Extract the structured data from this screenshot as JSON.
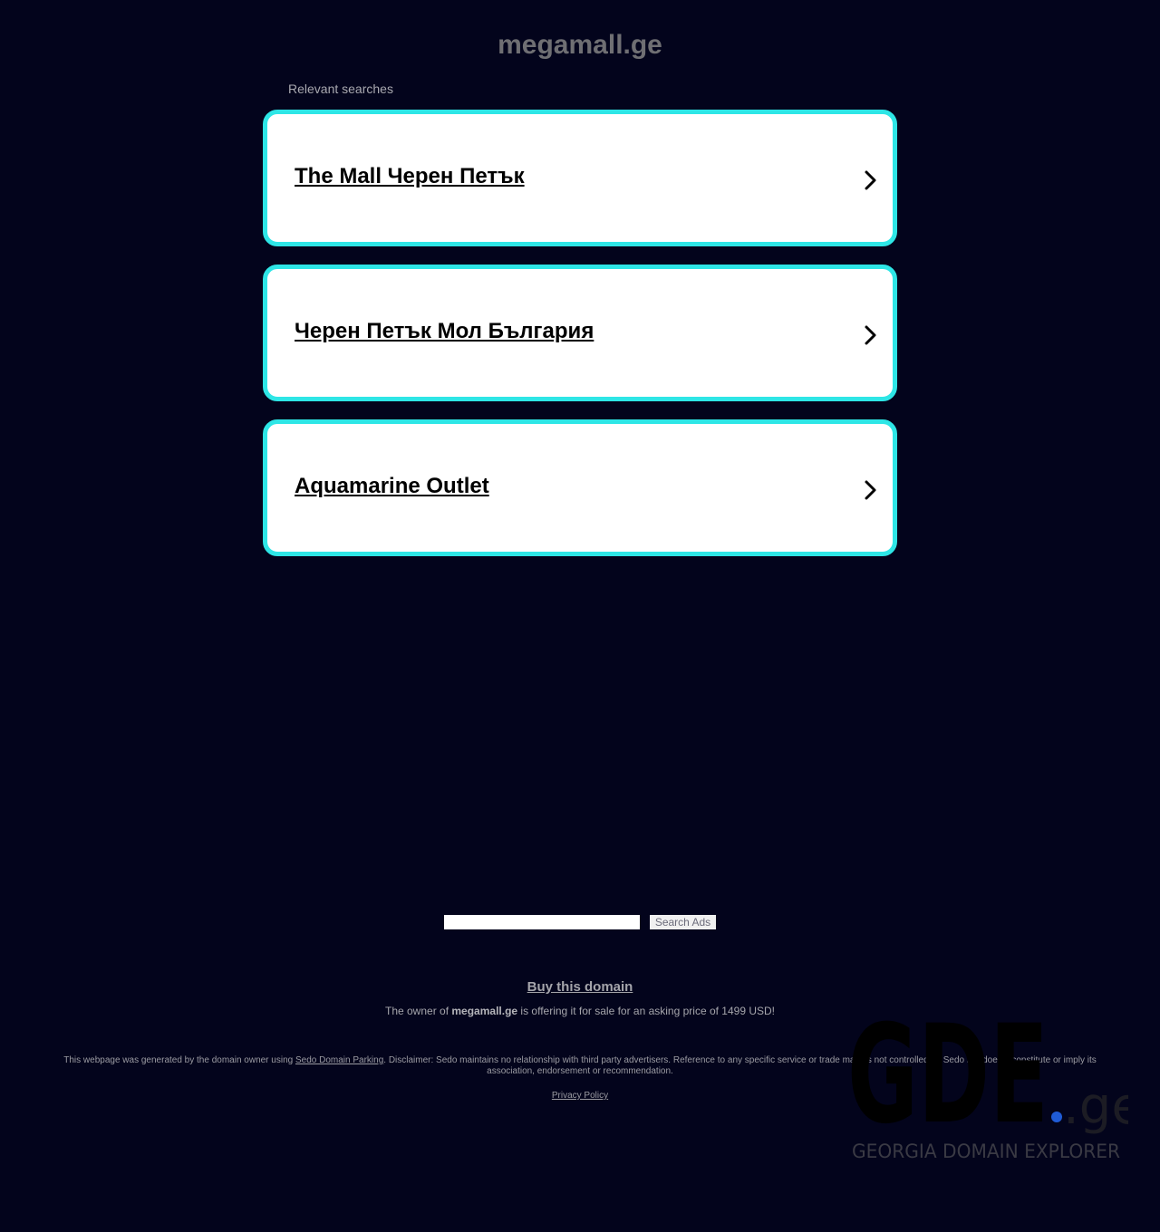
{
  "header": {
    "domain": "megamall.ge",
    "relevant_label": "Relevant searches"
  },
  "links": [
    {
      "label": "The Mall Черен Петък"
    },
    {
      "label": "Черен Петък Мол България"
    },
    {
      "label": "Aquamarine Outlet"
    }
  ],
  "search": {
    "value": "",
    "button_label": "Search Ads"
  },
  "sale": {
    "buy_label": "Buy this domain",
    "owner_prefix": "The owner of ",
    "owner_domain": "megamall.ge",
    "owner_suffix": " is offering it for sale for an asking price of 1499 USD!"
  },
  "footer": {
    "disclaimer_prefix": "This webpage was generated by the domain owner using ",
    "disclaimer_link": "Sedo Domain Parking",
    "disclaimer_suffix": ". Disclaimer: Sedo maintains no relationship with third party advertisers. Reference to any specific service or trade mark is not controlled by Sedo nor does it constitute or imply its association, endorsement or recommendation.",
    "privacy_label": "Privacy Policy"
  },
  "watermark": {
    "logo_text": "GDE",
    "logo_suffix": ".ge",
    "tagline": "GEORGIA DOMAIN EXPLORER",
    "dot_color": "#1f5bd6"
  },
  "colors": {
    "background": "#03041c",
    "card_border": "#2ee6e6",
    "card_background": "#ffffff"
  }
}
